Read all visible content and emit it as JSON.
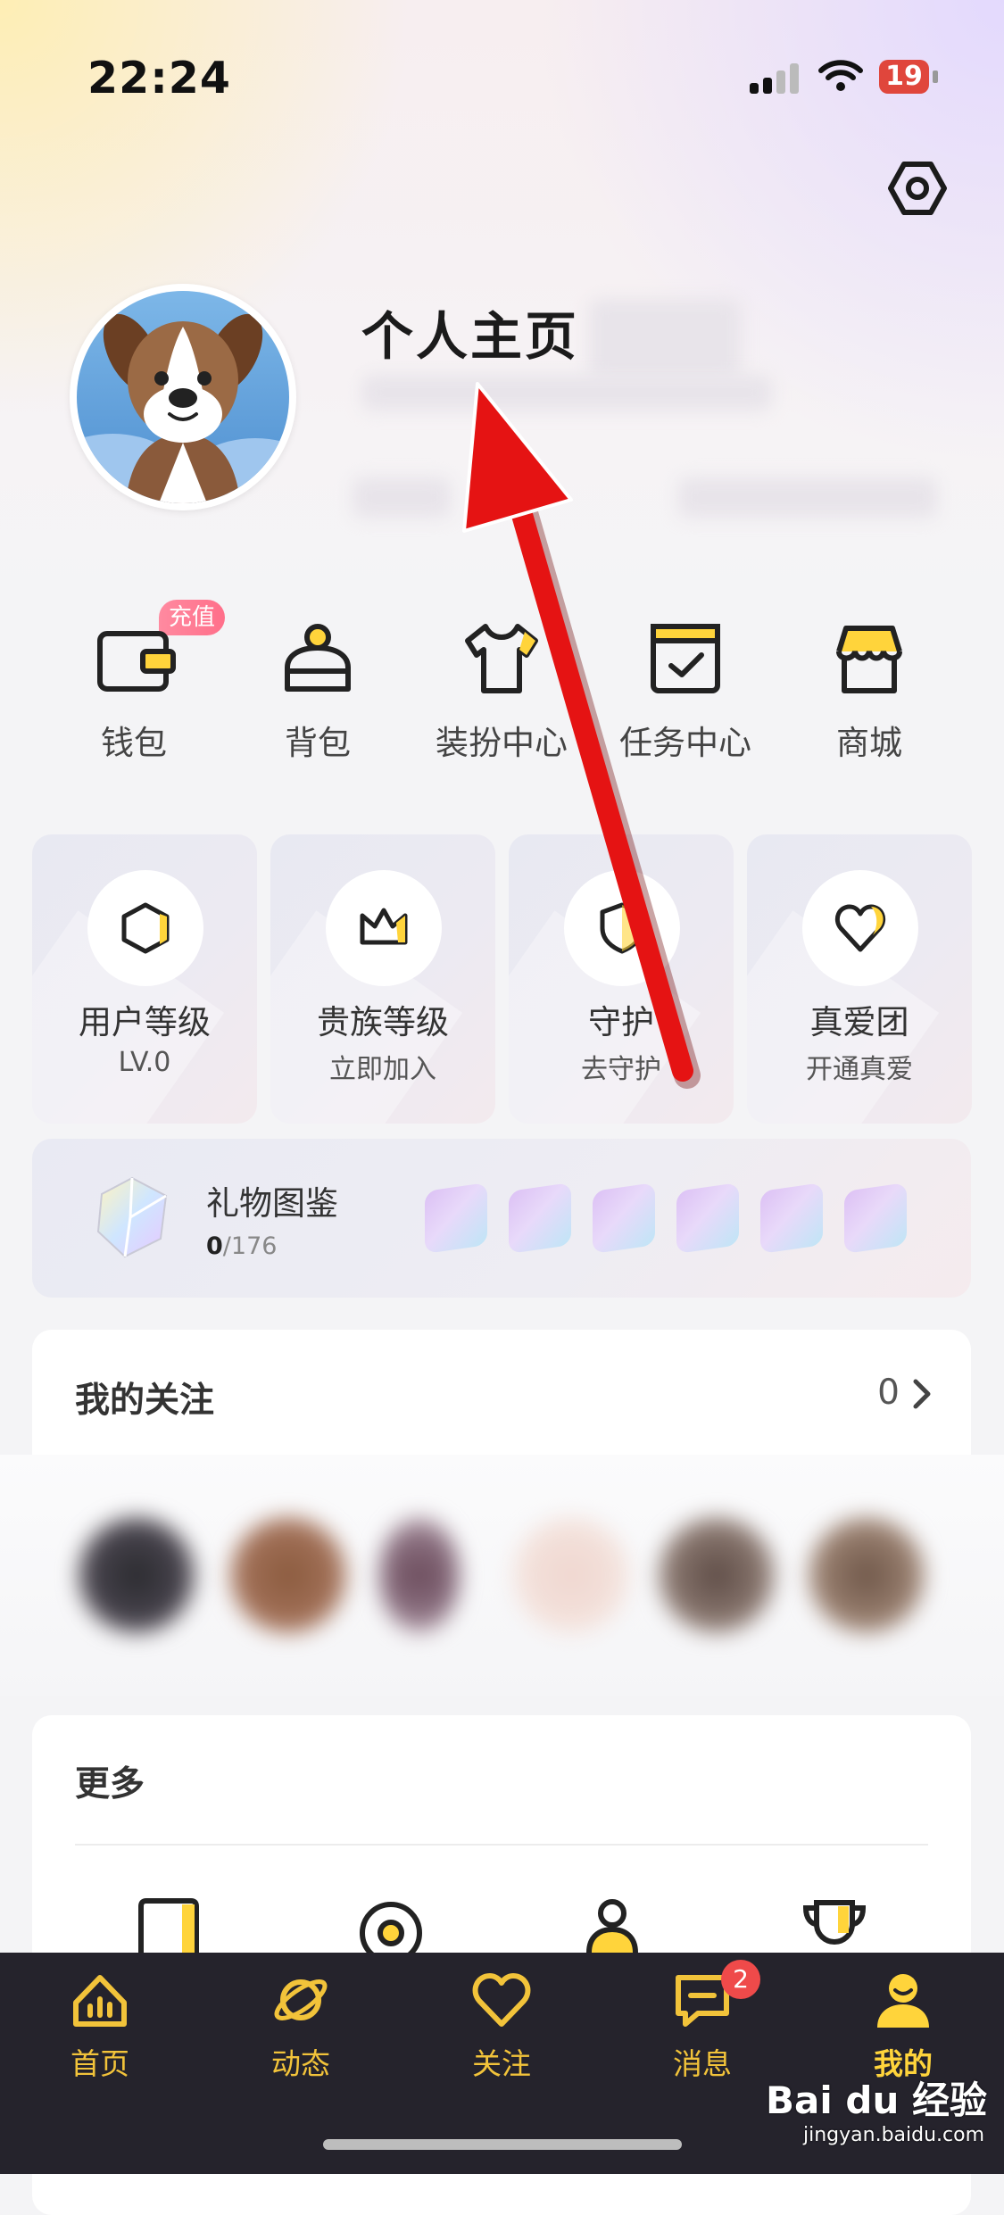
{
  "status": {
    "time": "22:24",
    "battery": "19"
  },
  "profile": {
    "name": "个人主页"
  },
  "quick_actions": [
    {
      "label": "钱包",
      "badge": "充值"
    },
    {
      "label": "背包"
    },
    {
      "label": "装扮中心"
    },
    {
      "label": "任务中心"
    },
    {
      "label": "商城"
    }
  ],
  "cards": [
    {
      "title": "用户等级",
      "sub": "LV.0"
    },
    {
      "title": "贵族等级",
      "sub": "立即加入"
    },
    {
      "title": "守护",
      "sub": "去守护"
    },
    {
      "title": "真爱团",
      "sub": "开通真爱"
    }
  ],
  "gift": {
    "title": "礼物图鉴",
    "owned": "0",
    "total": "/176"
  },
  "follow": {
    "title": "我的关注",
    "count": "0"
  },
  "more": {
    "title": "更多"
  },
  "tabs": [
    {
      "label": "首页",
      "icon": "chart-icon"
    },
    {
      "label": "动态",
      "icon": "planet-icon"
    },
    {
      "label": "关注",
      "icon": "heart-icon"
    },
    {
      "label": "消息",
      "icon": "message-icon",
      "badge": "2"
    },
    {
      "label": "我的",
      "icon": "user-icon"
    }
  ],
  "watermark": {
    "brand": "Bai du 经验",
    "url": "jingyan.baidu.com"
  },
  "colors": {
    "accent": "#ffd43b",
    "tab_bg": "#25232c",
    "badge_red": "#ef4a4a"
  }
}
